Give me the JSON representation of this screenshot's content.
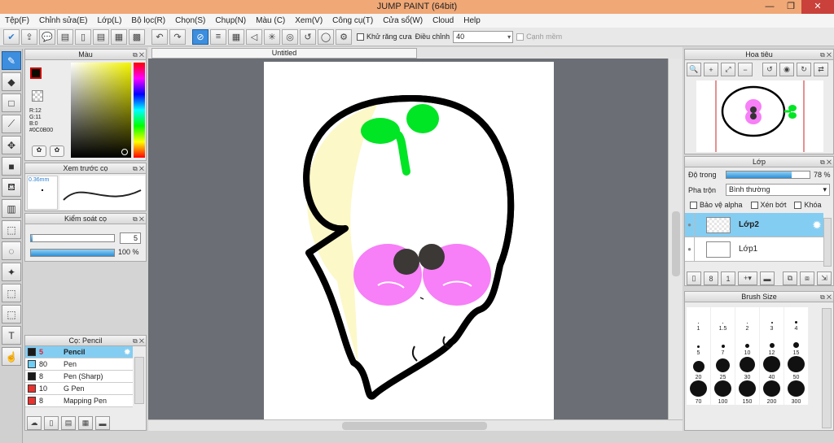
{
  "window": {
    "title": "JUMP PAINT (64bit)"
  },
  "menu": [
    "Tệp(F)",
    "Chỉnh sửa(E)",
    "Lớp(L)",
    "Bộ lọc(R)",
    "Chọn(S)",
    "Chụp(N)",
    "Màu (C)",
    "Xem(V)",
    "Công cụ(T)",
    "Cửa sổ(W)",
    "Cloud",
    "Help"
  ],
  "toolbar": {
    "antialias_label": "Khử răng cưa",
    "adjust_label": "Điều chỉnh",
    "adjust_value": "40",
    "snap_label": "Cạnh mềm"
  },
  "color_panel": {
    "title": "Màu",
    "r": "R:12",
    "g": "G:11",
    "b": "B:0",
    "hex": "#0C0B00",
    "fg": "#0C0B00"
  },
  "brush_preview": {
    "title": "Xem trước cọ",
    "size": "0.36mm"
  },
  "brush_control": {
    "title": "Kiểm soát cọ",
    "size_value": "5",
    "opacity_value": "100 %",
    "size_fraction": 0.02,
    "opacity_fraction": 1.0
  },
  "brush_list": {
    "title": "Cọ: Pencil",
    "items": [
      {
        "size": "5",
        "name": "Pencil",
        "color": "#1a1a1a"
      },
      {
        "size": "80",
        "name": "Pen",
        "color": "#6ecff6"
      },
      {
        "size": "8",
        "name": "Pen (Sharp)",
        "color": "#1a1a1a"
      },
      {
        "size": "10",
        "name": "G Pen",
        "color": "#e8322e"
      },
      {
        "size": "8",
        "name": "Mapping Pen",
        "color": "#e8322e"
      }
    ]
  },
  "document": {
    "tab_title": "Untitled"
  },
  "navigator": {
    "title": "Hoa tiêu"
  },
  "layers": {
    "title": "Lớp",
    "opacity_label": "Độ trong",
    "opacity_value": "78 %",
    "opacity_fraction": 0.78,
    "blend_label": "Pha trộn",
    "blend_value": "Bình thường",
    "protect_alpha": "Bảo vệ alpha",
    "clip": "Xén bớt",
    "lock": "Khóa",
    "items": [
      {
        "name": "Lớp2"
      },
      {
        "name": "Lớp1"
      }
    ]
  },
  "brush_size": {
    "title": "Brush Size",
    "sizes": [
      "1",
      "1.5",
      "2",
      "3",
      "4",
      "5",
      "7",
      "10",
      "12",
      "15",
      "20",
      "25",
      "30",
      "40",
      "50",
      "70",
      "100",
      "150",
      "200",
      "300"
    ]
  }
}
